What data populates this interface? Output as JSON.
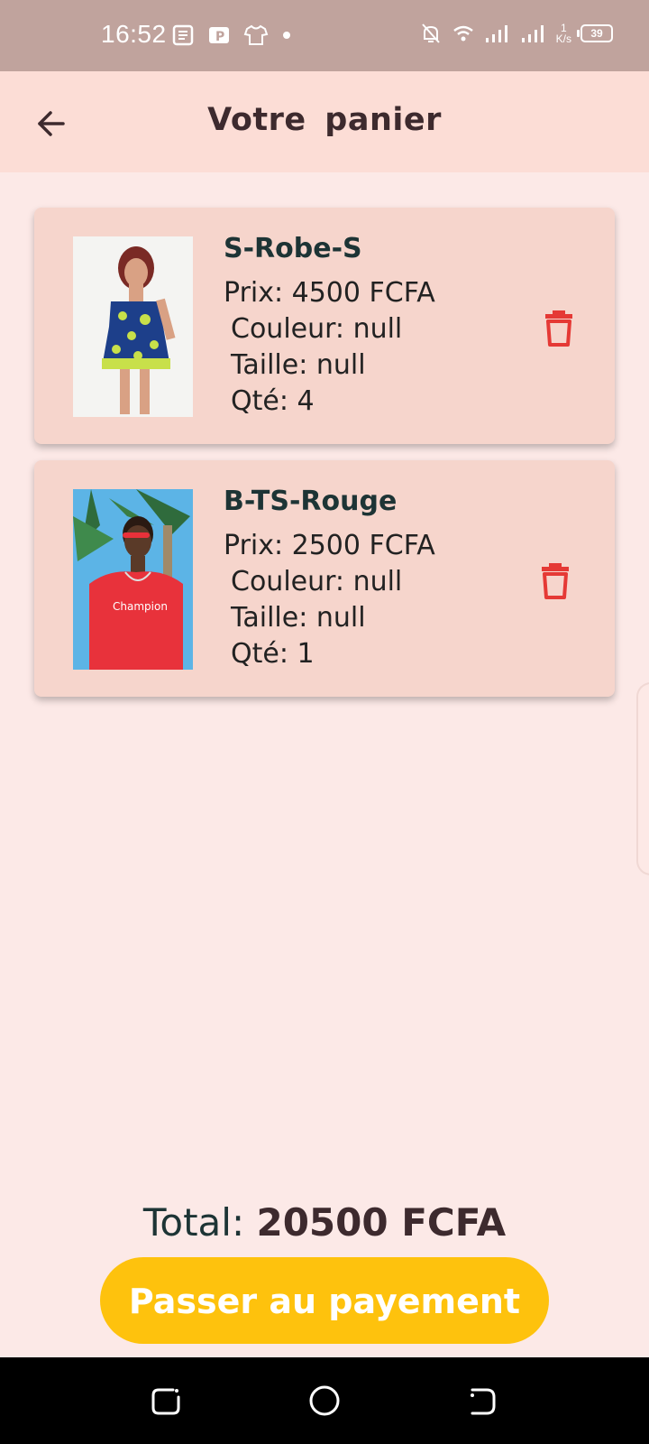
{
  "status_bar": {
    "time": "16:52",
    "net_speed_value": "1",
    "net_speed_unit": "K/s",
    "battery": "39"
  },
  "app_bar": {
    "title": "Votre  panier",
    "back_icon": "arrow-left-icon"
  },
  "cart": {
    "items": [
      {
        "name": "S-Robe-S",
        "price": "Prix: 4500 FCFA",
        "color": "Couleur: null",
        "size": "Taille: null",
        "qty": "Qté: 4",
        "image": "dress-photo"
      },
      {
        "name": "B-TS-Rouge",
        "price": "Prix: 2500 FCFA",
        "color": "Couleur: null",
        "size": "Taille: null",
        "qty": "Qté: 1",
        "image": "red-tshirt-photo"
      }
    ]
  },
  "footer": {
    "total_label": "Total: ",
    "total_value": "20500 FCFA",
    "pay_button": "Passer au payement"
  },
  "colors": {
    "accent": "#fec20d",
    "delete": "#e53935",
    "app_bar": "#fcddd6",
    "card": "#f6d5cc"
  }
}
